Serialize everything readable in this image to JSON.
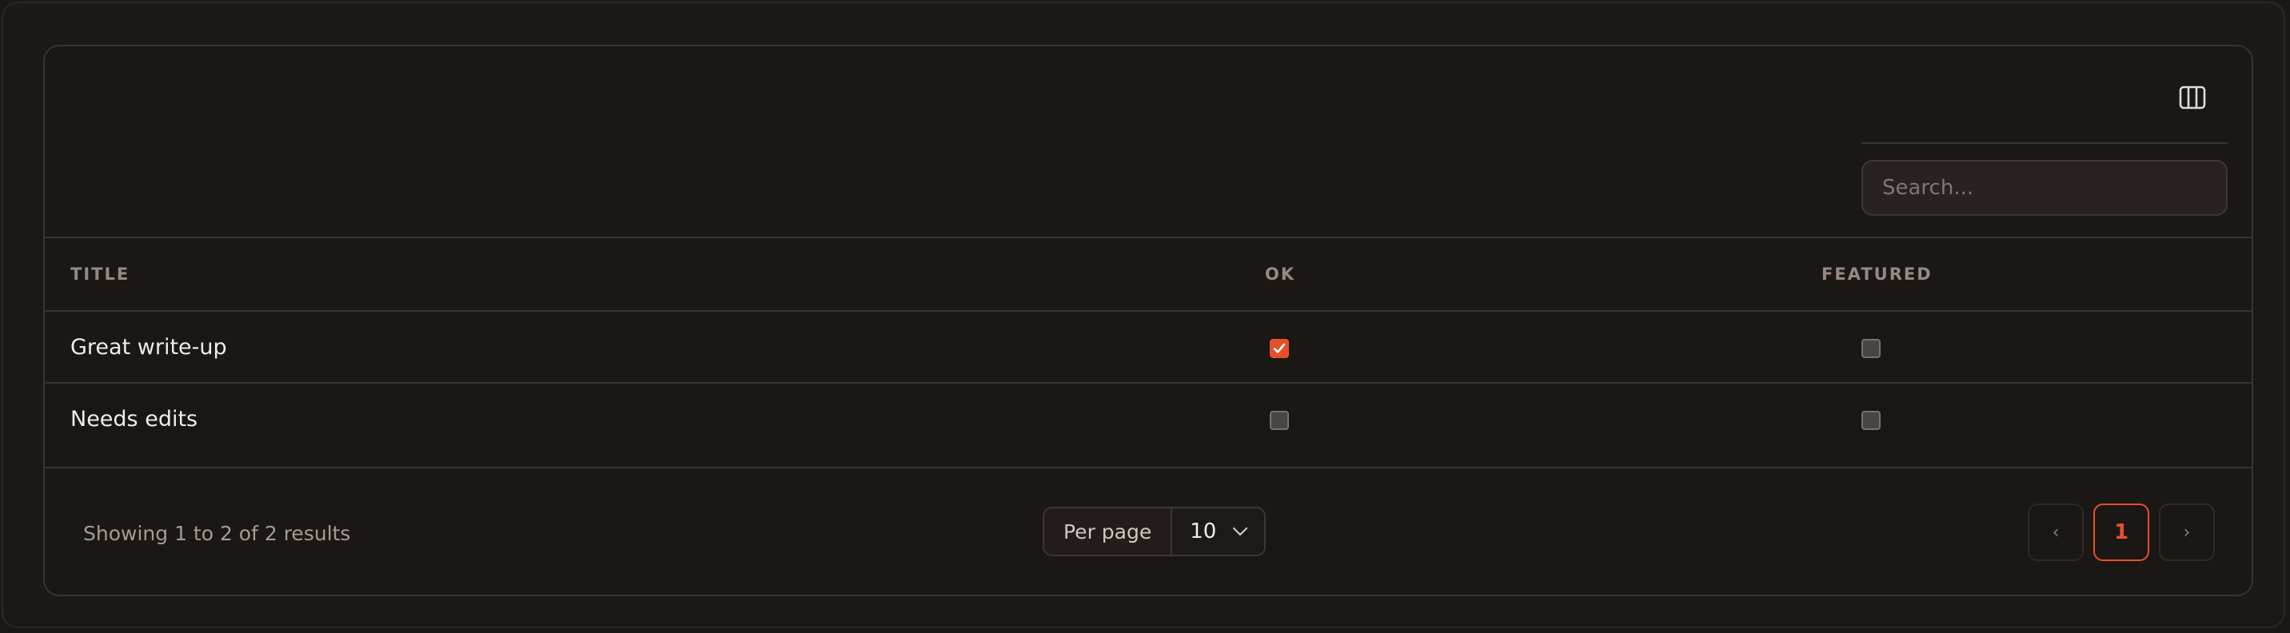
{
  "search": {
    "placeholder": "Search..."
  },
  "table": {
    "headers": {
      "title": "TITLE",
      "ok": "OK",
      "featured": "FEATURED"
    },
    "rows": [
      {
        "title": "Great write-up",
        "ok": true,
        "featured": false
      },
      {
        "title": "Needs edits",
        "ok": false,
        "featured": false
      }
    ]
  },
  "footer": {
    "summary": "Showing 1 to 2 of 2 results",
    "per_page_label": "Per page",
    "per_page_value": "10",
    "pagination": {
      "prev": "‹",
      "current_page": "1",
      "next": "›"
    }
  },
  "colors": {
    "accent": "#e5502a",
    "background": "#1b1714",
    "border": "#3a3430"
  },
  "icons": {
    "columns": "columns-icon",
    "checkmark": "check-icon",
    "chevron": "chevron-down-icon"
  }
}
